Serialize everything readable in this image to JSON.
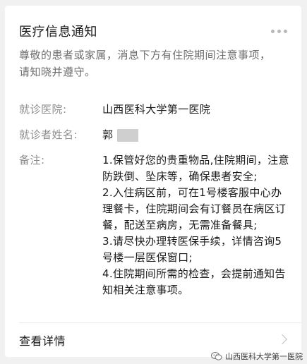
{
  "notification": {
    "title": "医疗信息通知",
    "intro": "尊敬的患者或家属，消息下方有住院期间注意事项，请知晓并遵守。",
    "fields": {
      "hospital_label": "就诊医院:",
      "hospital_value": "山西医科大学第一医院",
      "patient_label": "就诊者姓名:",
      "patient_value": "郭",
      "notes_label": "备注:",
      "notes": [
        "1.保管好您的贵重物品,住院期间，注意防跌倒、坠床等，确保患者安全;",
        "2.入住病区前，可在1号楼客服中心办理餐卡，住院期间会有订餐员在病区订餐，配送至病房，无需准备餐具;",
        "3.请尽快办理转医保手续，详情咨询5号楼一层医保窗口;",
        "4.住院期间所需的检查，会提前通知告知相关注意事项。"
      ]
    },
    "details_label": "查看详情"
  },
  "watermark": {
    "text": "山西医科大学第一医院"
  },
  "colors": {
    "background": "#f1f1f1",
    "card": "#ffffff",
    "title_text": "#191919",
    "secondary_text": "#8c8c8c"
  }
}
